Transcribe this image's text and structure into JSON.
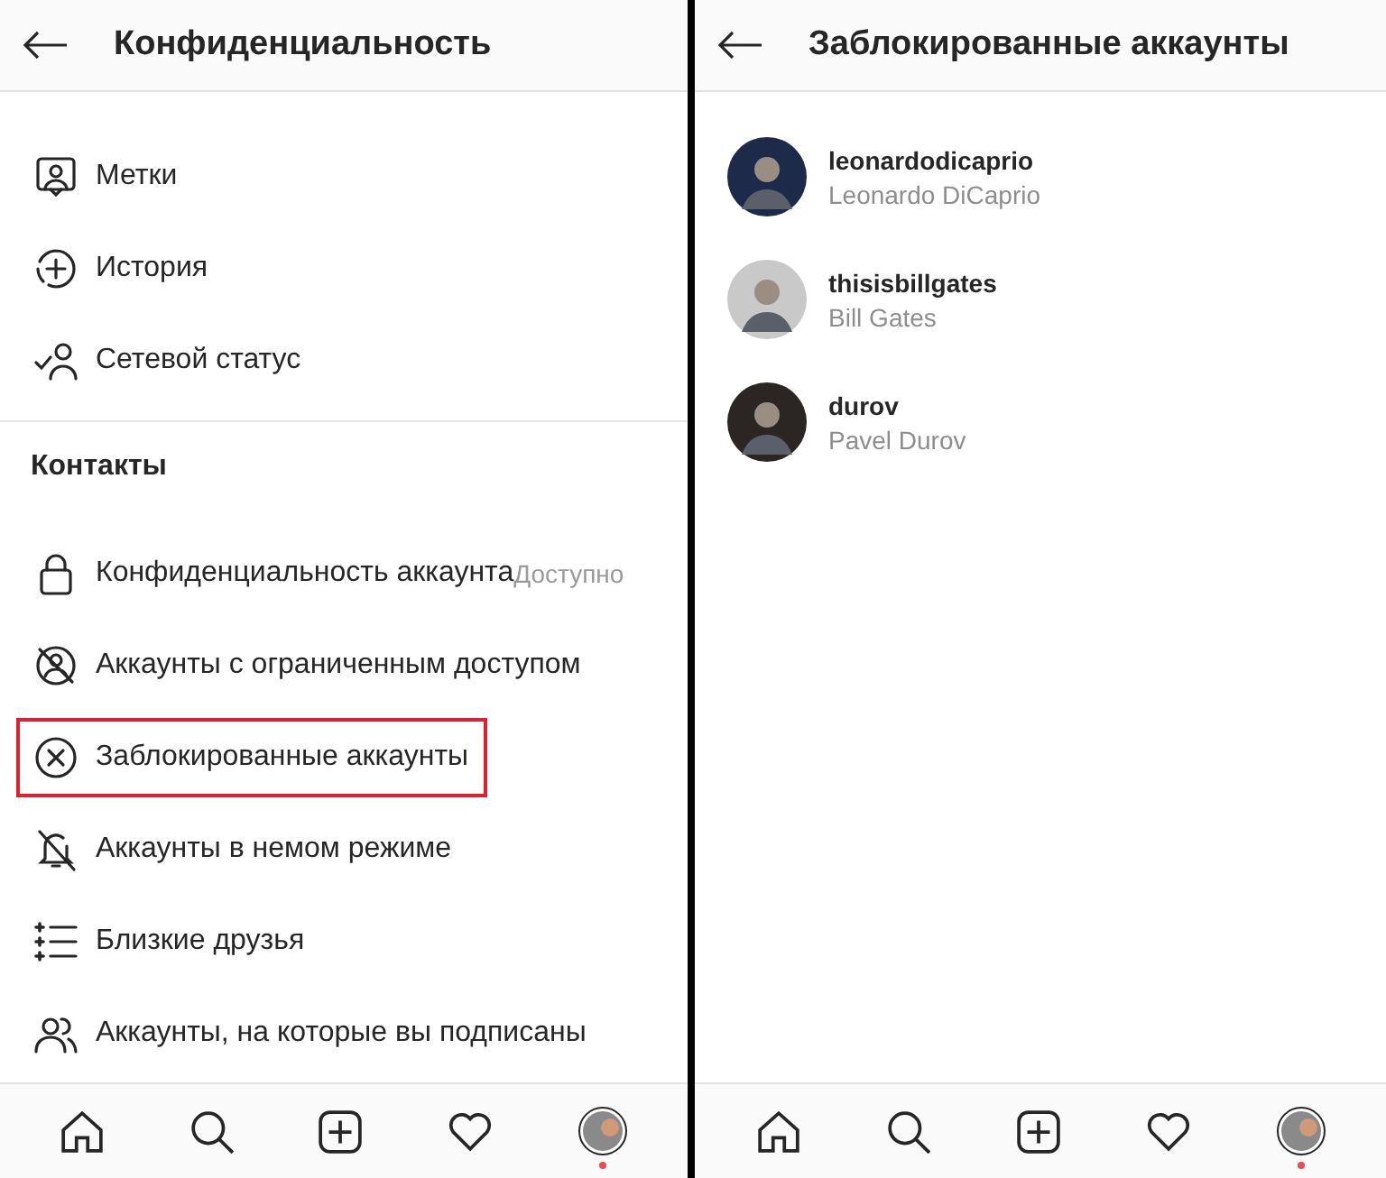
{
  "settings_panel": {
    "title": "Конфиденциальность",
    "items": [
      {
        "kind": "tag",
        "label": "Метки",
        "highlighted": false
      },
      {
        "kind": "story",
        "label": "История",
        "highlighted": false
      },
      {
        "kind": "status",
        "label": "Сетевой статус",
        "highlighted": false
      }
    ],
    "section": "Контакты",
    "contacts": [
      {
        "kind": "lock",
        "label": "Конфиденциальность аккаунта",
        "value": "Доступно",
        "highlighted": false
      },
      {
        "kind": "restricted",
        "label": "Аккаунты с ограниченным доступом",
        "highlighted": false
      },
      {
        "kind": "blocked",
        "label": "Заблокированные аккаунты",
        "highlighted": true
      },
      {
        "kind": "muted",
        "label": "Аккаунты в немом режиме",
        "highlighted": false
      },
      {
        "kind": "close-friends",
        "label": "Близкие друзья",
        "highlighted": false
      },
      {
        "kind": "following",
        "label": "Аккаунты, на которые вы подписаны",
        "highlighted": false
      }
    ],
    "nav": {
      "notification": true
    }
  },
  "blocked_panel": {
    "title": "Заблокированные аккаунты",
    "accounts": [
      {
        "username": "leonardodicaprio",
        "name": "Leonardo DiCaprio",
        "color": "#1e2a4a"
      },
      {
        "username": "thisisbillgates",
        "name": "Bill Gates",
        "color": "#c9c9c9"
      },
      {
        "username": "durov",
        "name": "Pavel Durov",
        "color": "#2b2623"
      }
    ],
    "nav": {
      "notification": true
    }
  }
}
